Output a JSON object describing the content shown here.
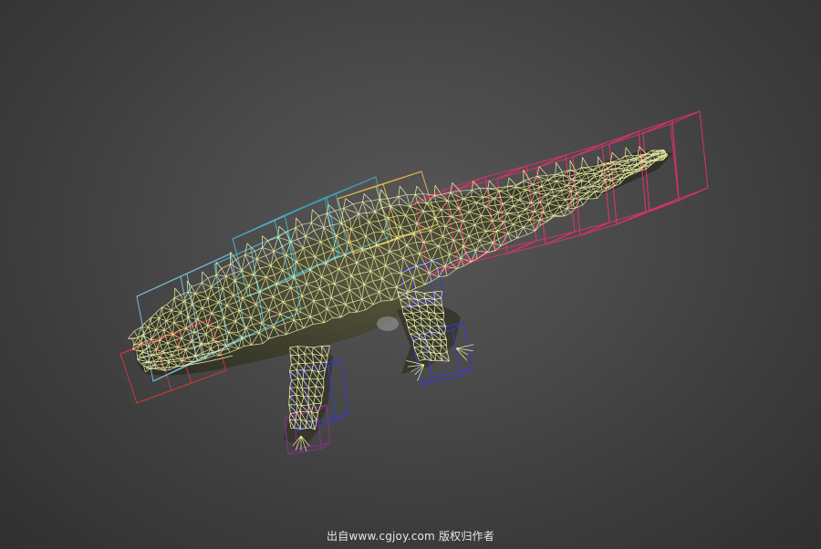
{
  "viewport": {
    "background": "#4a4a4a",
    "mesh_color": "#f2f5a8",
    "body_fill": "#3a3a26",
    "box_colors": {
      "head": "#79b9d8",
      "neck": "#4fb0c6",
      "spine": "#3f9eb3",
      "pelvis": "#e0b54a",
      "tail": "#d6326a",
      "jaw": "#c23a3a",
      "leg": "#3a3ad0",
      "foot": "#8a2f8f"
    }
  },
  "watermark": {
    "text": "出自www.cgjoy.com 版权归作者"
  }
}
